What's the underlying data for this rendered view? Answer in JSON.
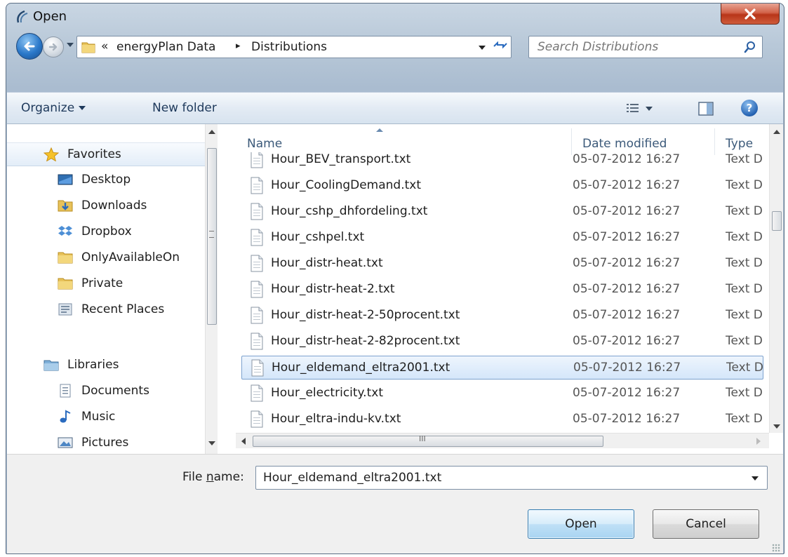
{
  "window": {
    "title": "Open"
  },
  "address": {
    "chevron": "«",
    "crumbs": [
      "energyPlan Data",
      "Distributions"
    ],
    "separator": "▸"
  },
  "search": {
    "placeholder": "Search Distributions"
  },
  "toolbar": {
    "organize_label": "Organize",
    "new_folder_label": "New folder"
  },
  "nav": {
    "favorites_label": "Favorites",
    "favorites": [
      "Desktop",
      "Downloads",
      "Dropbox",
      "OnlyAvailableOn",
      "Private",
      "Recent Places"
    ],
    "libraries_label": "Libraries",
    "libraries": [
      "Documents",
      "Music",
      "Pictures"
    ]
  },
  "columns": {
    "name": "Name",
    "date": "Date modified",
    "type": "Type"
  },
  "files": [
    {
      "name": "Hour_BEV_transport.txt",
      "date": "05-07-2012 16:27",
      "type": "Text D"
    },
    {
      "name": "Hour_CoolingDemand.txt",
      "date": "05-07-2012 16:27",
      "type": "Text D"
    },
    {
      "name": "Hour_cshp_dhfordeling.txt",
      "date": "05-07-2012 16:27",
      "type": "Text D"
    },
    {
      "name": "Hour_cshpel.txt",
      "date": "05-07-2012 16:27",
      "type": "Text D"
    },
    {
      "name": "Hour_distr-heat.txt",
      "date": "05-07-2012 16:27",
      "type": "Text D"
    },
    {
      "name": "Hour_distr-heat-2.txt",
      "date": "05-07-2012 16:27",
      "type": "Text D"
    },
    {
      "name": "Hour_distr-heat-2-50procent.txt",
      "date": "05-07-2012 16:27",
      "type": "Text D"
    },
    {
      "name": "Hour_distr-heat-2-82procent.txt",
      "date": "05-07-2012 16:27",
      "type": "Text D"
    },
    {
      "name": "Hour_eldemand_eltra2001.txt",
      "date": "05-07-2012 16:27",
      "type": "Text D",
      "selected": true
    },
    {
      "name": "Hour_electricity.txt",
      "date": "05-07-2012 16:27",
      "type": "Text D"
    },
    {
      "name": "Hour_eltra-indu-kv.txt",
      "date": "05-07-2012 16:27",
      "type": "Text D"
    }
  ],
  "scroll_grip": "III",
  "bottom": {
    "file_name_label_pre": "File ",
    "file_name_label_u": "n",
    "file_name_label_post": "ame:",
    "file_name_value": "Hour_eldemand_eltra2001.txt",
    "open_label": "Open",
    "cancel_label": "Cancel"
  },
  "colors": {
    "selection": "#d4e6fa",
    "accent": "#3c7fb1",
    "close": "#c8452a"
  }
}
